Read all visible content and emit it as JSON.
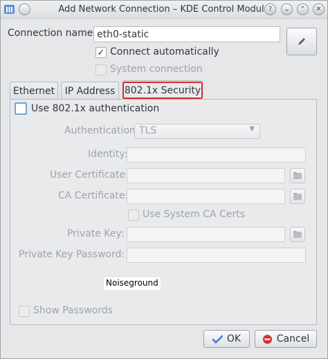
{
  "window": {
    "title": "Add Network Connection – KDE Control Module"
  },
  "connection": {
    "name_label": "Connection name:",
    "name_value": "eth0-static",
    "connect_automatically_label": "Connect automatically",
    "connect_automatically_checked": true,
    "system_connection_label": "System connection",
    "system_connection_checked": false
  },
  "tabs": [
    {
      "label": "Ethernet",
      "active": false
    },
    {
      "label": "IP Address",
      "active": false
    },
    {
      "label": "802.1x Security",
      "active": true
    }
  ],
  "security": {
    "use_8021x_label": "Use 802.1x authentication",
    "use_8021x_checked": false,
    "authentication_label": "Authentication:",
    "authentication_value": "TLS",
    "identity_label": "Identity:",
    "identity_value": "",
    "user_certificate_label": "User Certificate:",
    "user_certificate_value": "",
    "ca_certificate_label": "CA Certificate:",
    "ca_certificate_value": "",
    "use_system_ca_label": "Use System CA Certs",
    "private_key_label": "Private Key:",
    "private_key_value": "",
    "private_key_password_label": "Private Key Password:",
    "private_key_password_value": "",
    "overlay_text": "Noiseground",
    "show_passwords_label": "Show Passwords"
  },
  "buttons": {
    "ok_label": "OK",
    "cancel_label": "Cancel"
  },
  "colors": {
    "highlight": "#d42a2a",
    "ok_check": "#3d7fd1",
    "cancel_icon": "#d9302c"
  }
}
